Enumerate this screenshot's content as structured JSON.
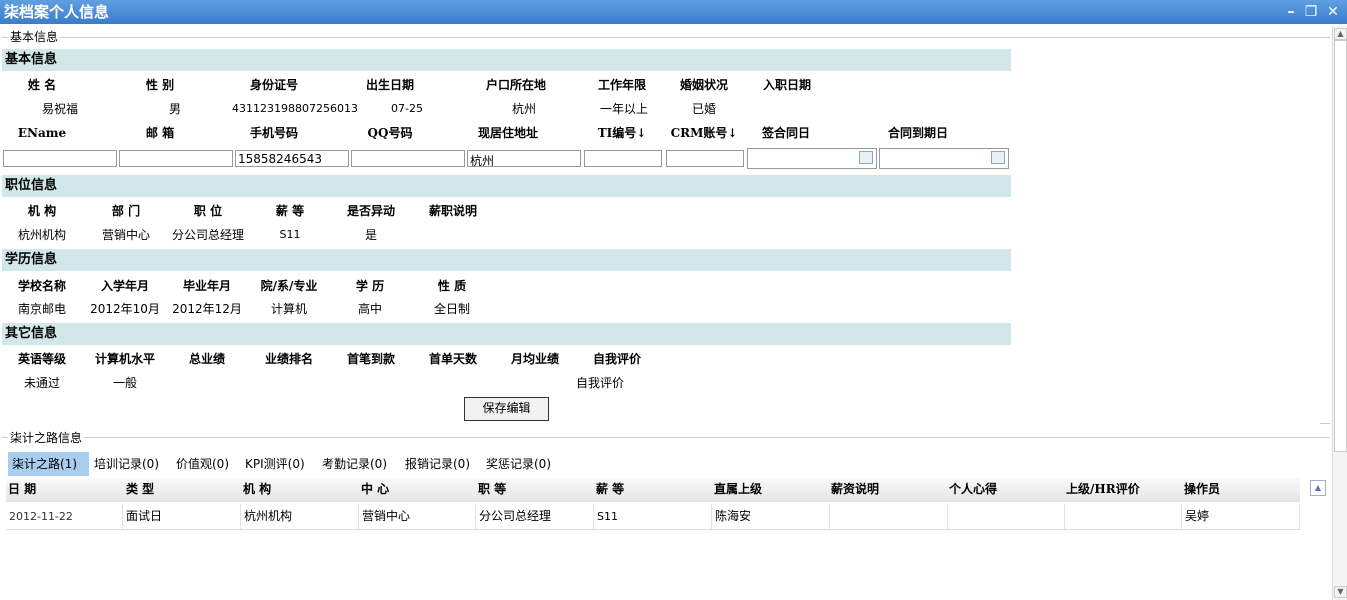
{
  "window": {
    "title": "柒档案个人信息"
  },
  "basic_fieldset": {
    "legend": "基本信息"
  },
  "basic": {
    "section_title": "基本信息",
    "labels1": [
      "姓 名",
      "性 别",
      "身份证号",
      "出生日期",
      "户口所在地",
      "工作年限",
      "婚姻状况",
      "入职日期"
    ],
    "values1": [
      "易祝福",
      "男",
      "431123198807256013",
      "07-25",
      "杭州",
      "一年以上",
      "已婚",
      ""
    ],
    "labels2": [
      "EName",
      "邮 箱",
      "手机号码",
      "QQ号码",
      "现居住地址",
      "TI编号↓",
      "CRM账号↓",
      "签合同日",
      "合同到期日"
    ],
    "inputs": [
      "",
      "",
      "15858246543",
      "",
      "杭州",
      "",
      "",
      "",
      ""
    ]
  },
  "job": {
    "section_title": "职位信息",
    "labels": [
      "机 构",
      "部 门",
      "职 位",
      "薪 等",
      "是否异动",
      "薪职说明"
    ],
    "values": [
      "杭州机构",
      "营销中心",
      "分公司总经理",
      "S11",
      "是",
      ""
    ]
  },
  "edu": {
    "section_title": "学历信息",
    "labels": [
      "学校名称",
      "入学年月",
      "毕业年月",
      "院/系/专业",
      "学 历",
      "性 质"
    ],
    "values": [
      "南京邮电",
      "2012年10月",
      "2012年12月",
      "计算机",
      "高中",
      "全日制"
    ]
  },
  "other": {
    "section_title": "其它信息",
    "labels": [
      "英语等级",
      "计算机水平",
      "总业绩",
      "业绩排名",
      "首笔到款",
      "首单天数",
      "月均业绩",
      "自我评价"
    ],
    "values": [
      "未通过",
      "一般",
      "",
      "",
      "",
      "",
      "",
      "自我评价"
    ]
  },
  "save_button": "保存编辑",
  "road_fieldset": {
    "legend": "柒计之路信息"
  },
  "tabs": [
    "柒计之路(1)",
    "培训记录(0)",
    "价值观(0)",
    "KPI测评(0)",
    "考勤记录(0)",
    "报销记录(0)",
    "奖惩记录(0)"
  ],
  "table": {
    "headers": [
      "日 期",
      "类 型",
      "机 构",
      "中 心",
      "职 等",
      "薪 等",
      "直属上级",
      "薪资说明",
      "个人心得",
      "上级/HR评价",
      "操作员"
    ],
    "rows": [
      [
        "2012-11-22",
        "面试日",
        "杭州机构",
        "营销中心",
        "分公司总经理",
        "S11",
        "陈海安",
        "",
        "",
        "",
        "吴婷"
      ]
    ]
  },
  "colors": {
    "title_bar": "#3a7ccb",
    "section_band": "#d1e7e9",
    "active_tab": "#a9cdef"
  }
}
